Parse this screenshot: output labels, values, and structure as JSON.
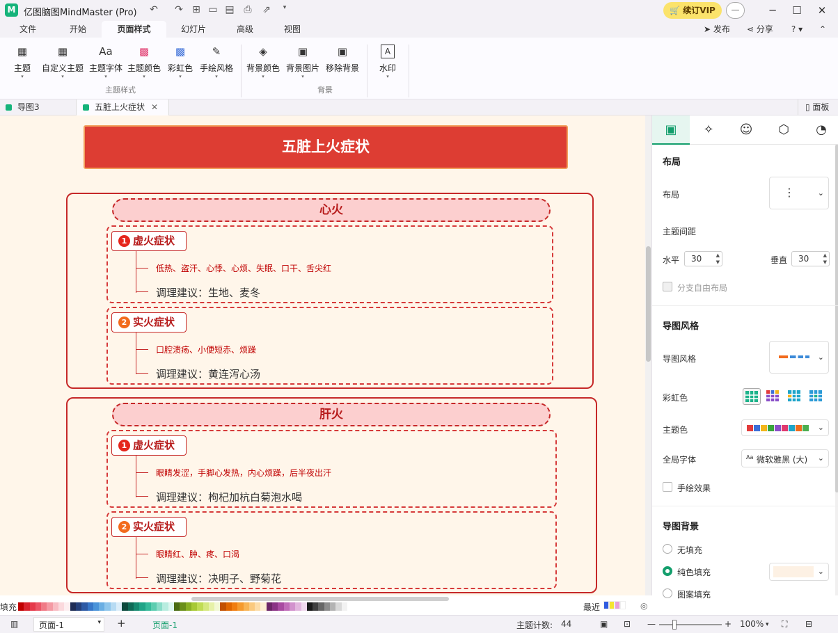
{
  "titlebar": {
    "app_title": "亿图脑图MindMaster (Pro)",
    "logo_glyph": "M",
    "vip_label": "续订VIP",
    "avatar_glyph": "—"
  },
  "menubar": {
    "tabs": [
      "文件",
      "开始",
      "页面样式",
      "幻灯片",
      "高级",
      "视图"
    ],
    "active_tab": "页面样式",
    "publish": "发布",
    "share": "分享",
    "help": "?"
  },
  "ribbon": {
    "buttons": [
      {
        "label": "主题",
        "icon": "grid-icon",
        "glyph": "▦"
      },
      {
        "label": "自定义主题",
        "icon": "custom-theme-icon",
        "glyph": "▦"
      },
      {
        "label": "主题字体",
        "icon": "font-icon",
        "glyph": "Aa"
      },
      {
        "label": "主题颜色",
        "icon": "palette-icon",
        "glyph": "▩"
      },
      {
        "label": "彩虹色",
        "icon": "rainbow-icon",
        "glyph": "▩"
      },
      {
        "label": "手绘风格",
        "icon": "hand-draw-icon",
        "glyph": "✎"
      },
      {
        "label": "背景颜色",
        "icon": "paint-bucket-icon",
        "glyph": "◈"
      },
      {
        "label": "背景图片",
        "icon": "image-icon",
        "glyph": "▣"
      },
      {
        "label": "移除背景",
        "icon": "remove-image-icon",
        "glyph": "▣"
      },
      {
        "label": "水印",
        "icon": "watermark-icon",
        "glyph": "A"
      }
    ],
    "group_theme": "主题样式",
    "group_background": "背景"
  },
  "doctabs": {
    "tabs": [
      "导图3",
      "五脏上火症状"
    ],
    "active": "五脏上火症状",
    "close": "✕",
    "panel_toggle": "面板"
  },
  "mindmap": {
    "root": "五脏上火症状",
    "organs": [
      {
        "title": "心火",
        "subs": [
          {
            "num": "1",
            "label": "虚火症状",
            "symptoms": "低热、盗汗、心悸、心烦、失眠、口干、舌尖红",
            "advice": "调理建议：生地、麦冬",
            "color": "#e5261c"
          },
          {
            "num": "2",
            "label": "实火症状",
            "symptoms": "口腔溃疡、小便短赤、烦躁",
            "advice": "调理建议：黄连泻心汤",
            "color": "#f26b1d"
          }
        ]
      },
      {
        "title": "肝火",
        "subs": [
          {
            "num": "1",
            "label": "虚火症状",
            "symptoms": "眼睛发涩，手脚心发热，内心烦躁，后半夜出汗",
            "advice": "调理建议：枸杞加杭白菊泡水喝",
            "color": "#e5261c"
          },
          {
            "num": "2",
            "label": "实火症状",
            "symptoms": "眼睛红、肿、疼、口渴",
            "advice": "调理建议：决明子、野菊花",
            "color": "#f26b1d"
          }
        ]
      }
    ]
  },
  "panel": {
    "tabs": [
      "layout-icon",
      "sparkle-icon",
      "emoji-icon",
      "badge-icon",
      "clock-icon"
    ],
    "tab_glyphs": [
      "▣",
      "✧",
      "☺",
      "⬡",
      "◔"
    ],
    "layout_heading": "布局",
    "layout_label": "布局",
    "spacing_label": "主题间距",
    "horizontal_label": "水平",
    "horizontal_value": "30",
    "vertical_label": "垂直",
    "vertical_value": "30",
    "free_layout_label": "分支自由布局",
    "style_heading": "导图风格",
    "style_label": "导图风格",
    "rainbow_label": "彩虹色",
    "theme_color_label": "主题色",
    "font_label": "全局字体",
    "font_value": "微软雅黑 (大)",
    "font_icon": "Aa",
    "hand_effect_label": "手绘效果",
    "bg_heading": "导图背景",
    "bg_none": "无填充",
    "bg_solid": "纯色填充",
    "bg_pattern": "图案填充",
    "bg_color": "#fdf1e4",
    "theme_colors": [
      "#e23b3b",
      "#3c6fd8",
      "#f3b51a",
      "#39a53c",
      "#8a4fc8",
      "#e0396e",
      "#1ea5c9",
      "#ef6b1e",
      "#4caf50"
    ]
  },
  "palette": {
    "fill_label": "填充",
    "recent_label": "最近",
    "colors": [
      "#c00000",
      "#d9232e",
      "#e5394a",
      "#eb5566",
      "#f07a86",
      "#f49aa4",
      "#f8bcc3",
      "#fbd9dd",
      "#fdeef0",
      "#1f2d56",
      "#25407a",
      "#2d5aa5",
      "#3777c9",
      "#4a93d9",
      "#6aaee3",
      "#8fc6ec",
      "#b7dbf3",
      "#dbedf9",
      "#0b4a3d",
      "#0f6b57",
      "#168a70",
      "#1fa487",
      "#35bb9b",
      "#5ccdb0",
      "#8addc9",
      "#b8ecdf",
      "#dcf6ef",
      "#4a6b12",
      "#6a8f1a",
      "#8ab024",
      "#a7c935",
      "#c0dc54",
      "#d5e87e",
      "#e6f1a8",
      "#f2f8d3",
      "#c25000",
      "#e06600",
      "#f07d10",
      "#f59a2e",
      "#f8b455",
      "#fac97e",
      "#fcdca8",
      "#fdeed3",
      "#6b2567",
      "#8a3385",
      "#a84aa1",
      "#c06cb9",
      "#d292cd",
      "#e2b6de",
      "#f0d9ee",
      "#1a1a1a",
      "#404040",
      "#666666",
      "#8c8c8c",
      "#b3b3b3",
      "#d9d9d9",
      "#f2f2f2",
      "#ffffff"
    ],
    "recent_colors": [
      "#2f5be0",
      "#f5e431",
      "#e8a0d6",
      "#ffffff"
    ]
  },
  "statusbar": {
    "page_label": "页面-1",
    "add_page": "+",
    "active_page": "页面-1",
    "topic_count_label": "主题计数:",
    "topic_count": "44",
    "zoom": "100%"
  }
}
